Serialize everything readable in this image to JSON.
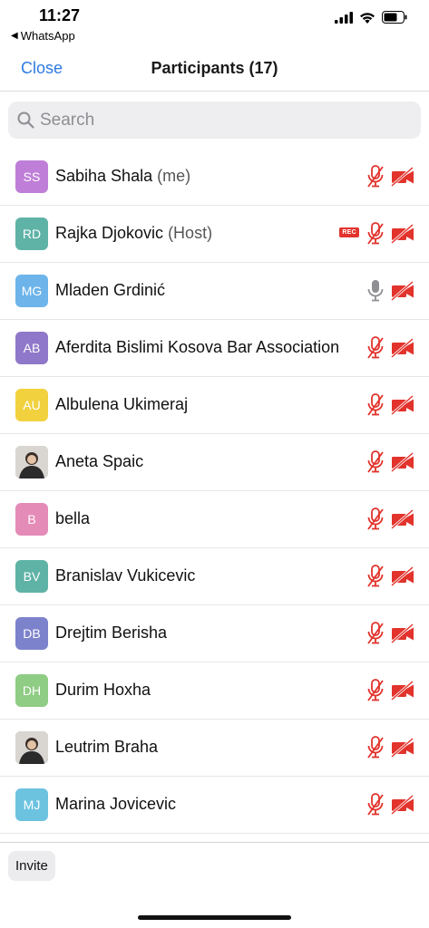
{
  "status_bar": {
    "time": "11:27",
    "back_app": "WhatsApp"
  },
  "nav": {
    "close_label": "Close",
    "title": "Participants (17)"
  },
  "search": {
    "placeholder": "Search"
  },
  "colors": {
    "accent": "#2d7be0",
    "muted_red": "#e2332c",
    "mic_on_gray": "#8e8e93"
  },
  "participants": [
    {
      "initials": "SS",
      "name": "Sabiha Shala",
      "role": "(me)",
      "avatar_color": "#bf7fd8",
      "photo": false,
      "rec": "",
      "mic": "muted",
      "camera": "off"
    },
    {
      "initials": "RD",
      "name": "Rajka Djokovic",
      "role": "(Host)",
      "avatar_color": "#5fb3a6",
      "photo": false,
      "rec": "REC",
      "mic": "muted",
      "camera": "off"
    },
    {
      "initials": "MG",
      "name": "Mladen Grdinić",
      "role": "",
      "avatar_color": "#6cb4ea",
      "photo": false,
      "rec": "",
      "mic": "on",
      "camera": "off"
    },
    {
      "initials": "AB",
      "name": "Aferdita Bislimi Kosova Bar Association",
      "role": "",
      "avatar_color": "#8f78c9",
      "photo": false,
      "rec": "",
      "mic": "muted",
      "camera": "off"
    },
    {
      "initials": "AU",
      "name": "Albulena Ukimeraj",
      "role": "",
      "avatar_color": "#f2d13f",
      "photo": false,
      "rec": "",
      "mic": "muted",
      "camera": "off"
    },
    {
      "initials": "",
      "name": "Aneta Spaic",
      "role": "",
      "avatar_color": "#8a8a8a",
      "photo": true,
      "rec": "",
      "mic": "muted",
      "camera": "off"
    },
    {
      "initials": "B",
      "name": "bella",
      "role": "",
      "avatar_color": "#e58bb8",
      "photo": false,
      "rec": "",
      "mic": "muted",
      "camera": "off"
    },
    {
      "initials": "BV",
      "name": "Branislav Vukicevic",
      "role": "",
      "avatar_color": "#5fb3a6",
      "photo": false,
      "rec": "",
      "mic": "muted",
      "camera": "off"
    },
    {
      "initials": "DB",
      "name": "Drejtim Berisha",
      "role": "",
      "avatar_color": "#7d82cc",
      "photo": false,
      "rec": "",
      "mic": "muted",
      "camera": "off"
    },
    {
      "initials": "DH",
      "name": "Durim Hoxha",
      "role": "",
      "avatar_color": "#8fcc84",
      "photo": false,
      "rec": "",
      "mic": "muted",
      "camera": "off"
    },
    {
      "initials": "",
      "name": "Leutrim Braha",
      "role": "",
      "avatar_color": "#6e6e6e",
      "photo": true,
      "rec": "",
      "mic": "muted",
      "camera": "off"
    },
    {
      "initials": "MJ",
      "name": "Marina Jovicevic",
      "role": "",
      "avatar_color": "#6cc3e0",
      "photo": false,
      "rec": "",
      "mic": "muted",
      "camera": "off"
    }
  ],
  "footer": {
    "invite_label": "Invite"
  }
}
